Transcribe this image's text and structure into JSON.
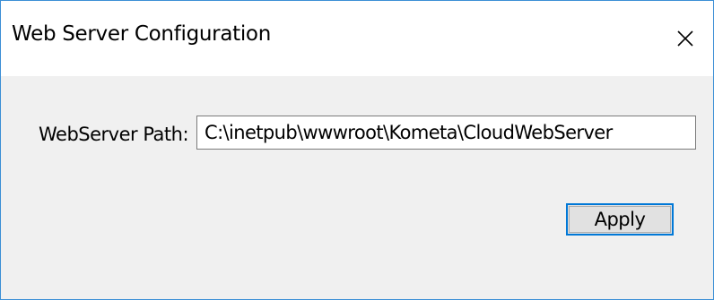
{
  "window": {
    "title": "Web Server Configuration",
    "close_icon": "close-icon"
  },
  "form": {
    "path_label": "WebServer Path:",
    "path_value": "C:\\inetpub\\wwwroot\\Kometa\\CloudWebServer",
    "apply_label": "Apply"
  },
  "colors": {
    "border_accent": "#3c8fd6",
    "button_focus": "#0078d7",
    "background": "#f0f0f0"
  }
}
